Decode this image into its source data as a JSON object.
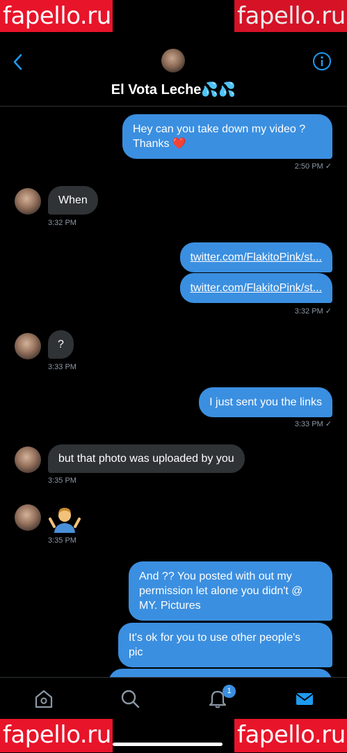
{
  "watermark": "fapello.ru",
  "header": {
    "title": "El Vota Leche💦💦"
  },
  "messages": [
    {
      "from": "me",
      "text_line1": "Hey can you take down my video ?",
      "text_line2": "Thanks ❤️",
      "time": "2:50 PM"
    },
    {
      "from": "them",
      "text": "When",
      "time": "3:32 PM"
    },
    {
      "from": "me",
      "link1": "twitter.com/FlakitoPink/st...",
      "link2": "twitter.com/FlakitoPink/st...",
      "time": "3:32 PM"
    },
    {
      "from": "them",
      "text": "?",
      "time": "3:33 PM"
    },
    {
      "from": "me",
      "text": "I just sent you the links",
      "time": "3:33 PM"
    },
    {
      "from": "them",
      "text": "but that photo was uploaded by you",
      "time": "3:35 PM"
    },
    {
      "from": "them",
      "emoji": "man-shrugging",
      "time": "3:35 PM"
    },
    {
      "from": "me",
      "text_line1": "And ?? You posted with out my",
      "text_line2": "permission let alone you didn't @",
      "text_line3": "MY. Pictures"
    },
    {
      "from": "me",
      "text_line1": "It's ok for you to use other people's",
      "text_line2": "pic"
    }
  ],
  "read_mark": "✓",
  "tabbar": {
    "notification_count": "1"
  },
  "colors": {
    "outgoing": "#3b8fe0",
    "incoming": "#2f3336",
    "accent": "#1d9bf0",
    "watermark": "#e8142a"
  }
}
